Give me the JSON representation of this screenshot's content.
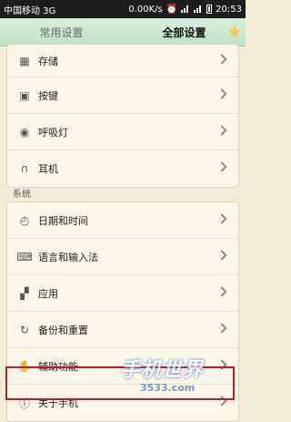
{
  "status_bar": {
    "carrier": "中国移动 3G",
    "speed": "0.00K/s",
    "time": "20:53"
  },
  "tabs": [
    {
      "label": "常用设置"
    },
    {
      "label": "全部设置"
    }
  ],
  "device_group": [
    {
      "label": "存储",
      "icon": "storage-icon"
    },
    {
      "label": "按键",
      "icon": "keys-icon"
    },
    {
      "label": "呼吸灯",
      "icon": "breathing-light-icon"
    },
    {
      "label": "耳机",
      "icon": "headphones-icon"
    }
  ],
  "system_section": {
    "title": "系统",
    "items": [
      {
        "label": "日期和时间",
        "icon": "clock-icon"
      },
      {
        "label": "语言和输入法",
        "icon": "keyboard-icon"
      },
      {
        "label": "应用",
        "icon": "apps-icon"
      },
      {
        "label": "备份和重置",
        "icon": "backup-icon"
      },
      {
        "label": "辅助功能",
        "icon": "hand-icon"
      },
      {
        "label": "关于手机",
        "icon": "info-icon"
      }
    ]
  },
  "watermark": {
    "text": "手机世界",
    "sub": "3533.com"
  }
}
